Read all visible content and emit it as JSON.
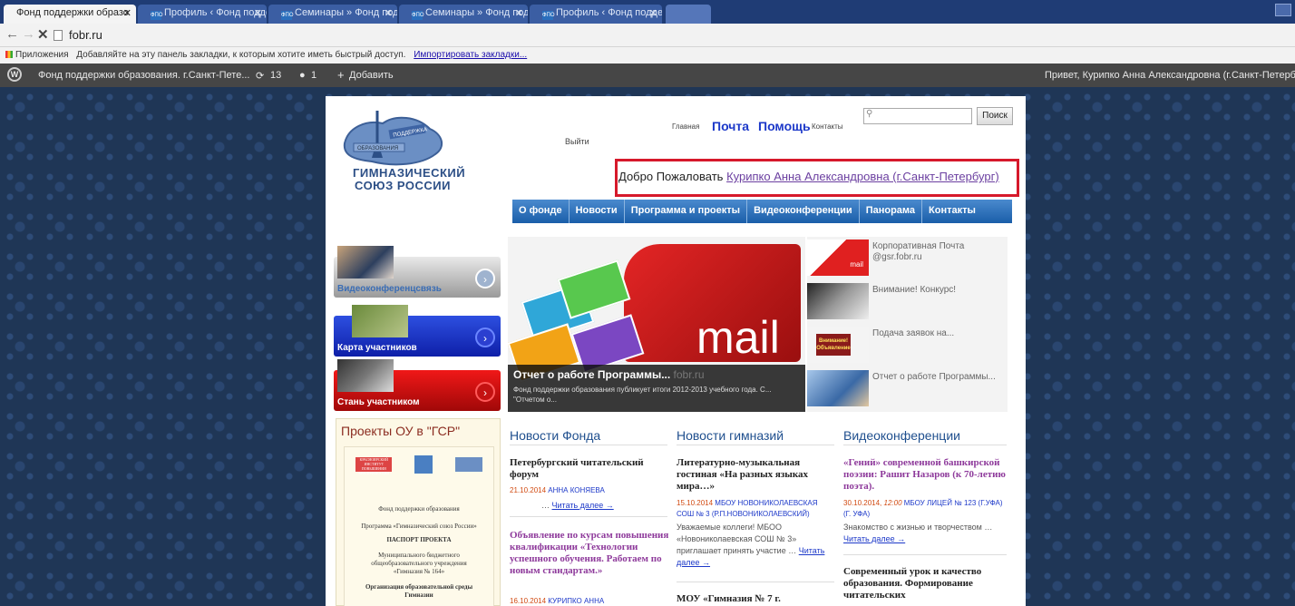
{
  "browser": {
    "tabs": [
      {
        "title": "Фонд поддержки образо",
        "active": true
      },
      {
        "title": "Профиль ‹ Фонд поддерж",
        "active": false
      },
      {
        "title": "Семинары » Фонд подде",
        "active": false
      },
      {
        "title": "Семинары » Фонд подде",
        "active": false
      },
      {
        "title": "Профиль ‹ Фонд поддерж",
        "active": false
      }
    ],
    "url": "fobr.ru",
    "bookmarks": {
      "apps_label": "Приложения",
      "hint": "Добавляйте на эту панель закладки, к которым хотите иметь быстрый доступ.",
      "import_link": "Импортировать закладки..."
    }
  },
  "adminbar": {
    "site_name": "Фонд поддержки образования. г.Санкт-Пете...",
    "updates_count": "13",
    "comments_count": "1",
    "add_label": "Добавить",
    "greeting": "Привет, Курипко Анна Александровна (г.Санкт-Петербург)"
  },
  "header": {
    "logo_banner": "ПОДДЕРЖКА",
    "logo_ribbon": "ОБРАЗОВАНИЯ",
    "logo_line1": "ГИМНАЗИЧЕСКИЙ",
    "logo_line2": "СОЮЗ РОССИИ",
    "logout": "Выйти",
    "home": "Главная",
    "mail": "Почта",
    "help": "Помощь",
    "contacts": "Контакты",
    "search_placeholder": "",
    "search_button": "Поиск",
    "welcome_prefix": "Добро Пожаловать",
    "welcome_user": "Курипко Анна Александровна (г.Санкт-Петербург)"
  },
  "menu": [
    "О фонде",
    "Новости",
    "Программа и проекты",
    "Видеоконференции",
    "Панорама",
    "Контакты"
  ],
  "sidebar": {
    "buttons": [
      "Видеоконференцсвязь",
      "Карта участников",
      "Стань участником"
    ],
    "projects_title": "Проекты ОУ в \"ГСР\"",
    "doc_lines": [
      "КРАСНОЯРСКИЙ ИНСТИТУТ ПОВЫШЕНИЯ КВАЛИФИКАЦИИ",
      "Фонд поддержки образования",
      "Программа «Гимназический союз России»",
      "ПАСПОРТ ПРОЕКТА",
      "Муниципального бюджетного общеобразовательного учреждения «Гимназия № 164»",
      "Организация образовательной среды Гимназии"
    ]
  },
  "slider": {
    "image_word": "mail",
    "caption_title": "Отчет о работе Программы...",
    "watermark": "fobr.ru",
    "caption_text": "Фонд поддержки образования публикует итоги 2012-2013 учебного года. С... \"Отчетом о...",
    "thumbs": [
      {
        "text": "Корпоративная Почта @gsr.fobr.ru",
        "img_word": "mail"
      },
      {
        "text": "Внимание! Конкурс!",
        "img_word": ""
      },
      {
        "text": "Подача заявок на...",
        "img_word": "Внимание! Объявление"
      },
      {
        "text": "Отчет о работе Программы...",
        "img_word": ""
      }
    ]
  },
  "columns": [
    {
      "title": "Новости Фонда",
      "posts": [
        {
          "title": "Петербургский читательский форум",
          "date": "21.10.2014",
          "author": "АННА КОНЯЕВА",
          "more": "Читать далее →"
        },
        {
          "title": "Объявление по курсам повышения квалификации «Технологии успешного обучения. Работаем по новым стандартам.»",
          "date": "16.10.2014",
          "author": "КУРИПКО АННА"
        }
      ]
    },
    {
      "title": "Новости гимназий",
      "posts": [
        {
          "title": "Литературно-музыкальная гостиная «На разных языках мира…»",
          "date": "15.10.2014",
          "author": "МБОУ НОВОНИКОЛАЕВСКАЯ СОШ № 3 (Р.П.НОВОНИКОЛАЕВСКИЙ)",
          "excerpt": "Уважаемые коллеги! МБОО «Новониколаевская СОШ № 3» приглашает принять участие …",
          "more": "Читать далее →"
        },
        {
          "title": "МОУ «Гимназия № 7 г."
        }
      ]
    },
    {
      "title": "Видеоконференции",
      "posts": [
        {
          "title": "«Гений» современной башкирской поэзии: Рашит Назаров (к 70-летию поэта).",
          "date": "30.10.2014,",
          "time": "12:00",
          "author": "МБОУ ЛИЦЕЙ № 123 (Г.УФА) (Г. УФА)",
          "excerpt": "Знакомство с жизнью и творчеством …",
          "more": "Читать далее →"
        },
        {
          "title": "Современный урок и качество образования. Формирование читательских"
        }
      ]
    }
  ],
  "colors": {
    "accent_red": "#d6192b",
    "menu_blue": "#1a5ea9",
    "link_blue": "#1d39c9",
    "heading_purple": "#8e3a9b"
  }
}
